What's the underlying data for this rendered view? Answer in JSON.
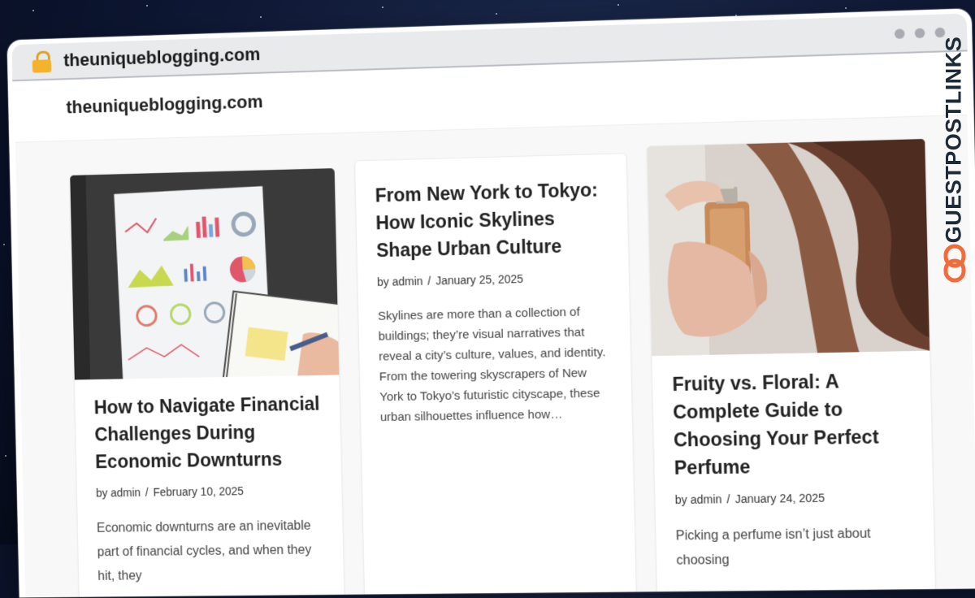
{
  "browser": {
    "url": "theuniqueblogging.com"
  },
  "site": {
    "title": "theuniqueblogging.com"
  },
  "posts": [
    {
      "title": "How to Navigate Financial Challenges During Economic Downturns",
      "author": "by admin",
      "separator": "/",
      "date": "February 10, 2025",
      "excerpt": "Economic downturns are an inevitable part of financial cycles, and when they hit, they"
    },
    {
      "title": "From New York to Tokyo: How Iconic Skylines Shape Urban Culture",
      "author": "by admin",
      "separator": "/",
      "date": "January 25, 2025",
      "excerpt": "Skylines are more than a collection of buildings; they’re visual narratives that reveal a city’s culture, values, and identity. From the towering skyscrapers of New York to Tokyo’s futuristic cityscape, these urban silhouettes influence how…"
    },
    {
      "title": "Fruity vs. Floral: A Complete Guide to Choosing Your Perfect Perfume",
      "author": "by admin",
      "separator": "/",
      "date": "January 24, 2025",
      "excerpt": "Picking a perfume isn’t just about choosing"
    }
  ],
  "brand": {
    "watermark": "GUESTPOSTLINKS",
    "accent_color": "#f26b3a"
  },
  "colors": {
    "lock": "#f5b22c",
    "background": "#0c1530"
  },
  "icons": [
    "lock-icon",
    "window-dot-icon",
    "link-chain-icon"
  ]
}
